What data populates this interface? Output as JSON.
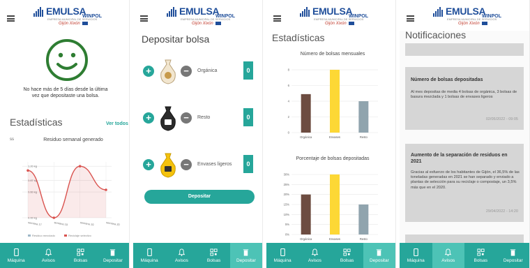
{
  "brand": {
    "name": "EMULSA",
    "tagline": "EMPRESA MUNICIPAL DE SERVICIOS",
    "city": "Gijón Xixón",
    "partner": "WINPOL"
  },
  "nav": {
    "items": [
      {
        "label": "Máquina",
        "icon": "phone-icon"
      },
      {
        "label": "Avisos",
        "icon": "bell-icon"
      },
      {
        "label": "Bolsas",
        "icon": "qr-icon"
      },
      {
        "label": "Depositar",
        "icon": "trash-icon"
      }
    ]
  },
  "screen1": {
    "message": "No hace más de 5 días desde la última vez que depositaste una bolsa.",
    "section_title": "Estadísticas",
    "see_all": "Ver todos",
    "tab_short": "ss",
    "chart_title": "Residuo semanal generado",
    "y_ticks": [
      "1.20 kg",
      "0.87 kg",
      "0.60 kg",
      "0.00 kg"
    ],
    "x_ticks": [
      "semana 17",
      "semana 18",
      "semana 19",
      "semana 20"
    ],
    "legend": [
      "Residuo mezclado",
      "Reciclaje selectivo"
    ],
    "colors": {
      "smile": "#2e7d32",
      "line": "#d9534f"
    }
  },
  "screen2": {
    "title": "Depositar bolsa",
    "bags": [
      {
        "name": "Orgánica",
        "count": "0"
      },
      {
        "name": "Resto",
        "count": "0"
      },
      {
        "name": "Envases ligeros",
        "count": "0"
      }
    ],
    "button": "Depositar"
  },
  "screen3": {
    "title": "Estadísticas",
    "monthly_title": "Número de bolsas mensuales",
    "percent_title": "Porcentaje de bolsas depositadas"
  },
  "screen4": {
    "title": "Notificaciones",
    "cards": [
      {
        "title": "Número de bolsas depositadas",
        "body": "Al mes depositas de media 4 bolsas de orgánica, 3 bolsas de basura mezclada y 1 bolsas de envases ligeros",
        "date": "02/05/2022 - 09:05"
      },
      {
        "title": "Aumento de la separación de residuos en 2021",
        "body": "Gracias al esfuerzo de los habitantes de Gijón, el 36,5% de las toneladas generadas en 2021 se han separado y enviado a plantas de selección para su reciclaje o compostaje, un 3,5% más que en el 2020.",
        "date": "29/04/2022 - 14:20"
      }
    ]
  },
  "chart_data": [
    {
      "type": "line",
      "title": "Residuo semanal generado",
      "x": [
        "semana 17",
        "semana 18",
        "semana 19",
        "semana 20"
      ],
      "series": [
        {
          "name": "Reciclaje selectivo",
          "values": [
            1.1,
            0.0,
            1.2,
            0.65
          ]
        }
      ],
      "ylim": [
        0,
        1.3
      ],
      "grid": true,
      "legend": "bottom"
    },
    {
      "type": "bar",
      "title": "Número de bolsas mensuales",
      "categories": [
        "Orgánica",
        "Envases",
        "Resto"
      ],
      "values": [
        4.9,
        8,
        4
      ],
      "colors": [
        "#6d4c41",
        "#fdd835",
        "#90a4ae"
      ],
      "ylim": [
        0,
        8
      ],
      "y_ticks": [
        "0",
        "2",
        "4",
        "6",
        "8"
      ]
    },
    {
      "type": "bar",
      "title": "Porcentaje de bolsas depositadas",
      "categories": [
        "Orgánica",
        "Envases",
        "Resto"
      ],
      "values": [
        20,
        30,
        15
      ],
      "colors": [
        "#6d4c41",
        "#fdd835",
        "#90a4ae"
      ],
      "ylim": [
        0,
        30
      ],
      "y_ticks": [
        "0%",
        "5%",
        "10%",
        "15%",
        "20%",
        "25%",
        "30%"
      ]
    }
  ]
}
